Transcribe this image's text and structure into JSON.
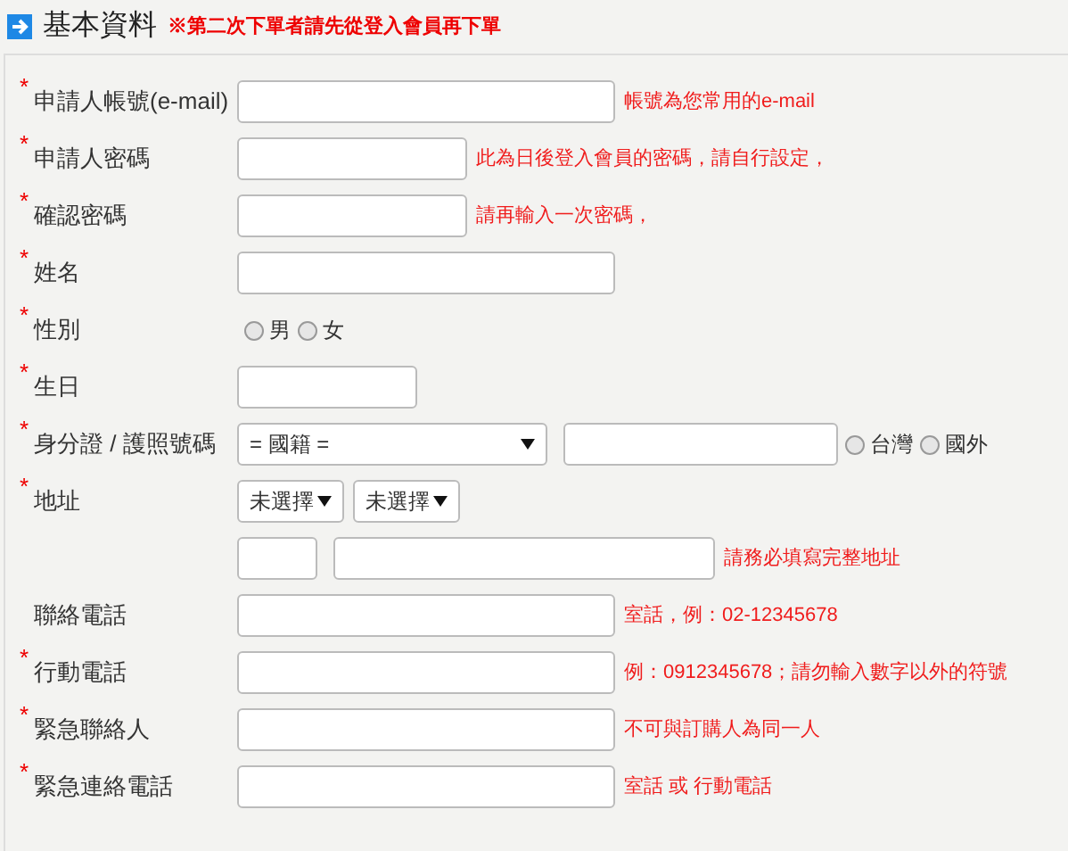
{
  "header": {
    "title": "基本資料",
    "note": "※第二次下單者請先從登入會員再下單"
  },
  "rows": [
    {
      "kind": "text",
      "label": "申請人帳號(e-mail)",
      "marker": "*",
      "hint": "帳號為您常用的e-mail"
    },
    {
      "kind": "text",
      "label": "申請人密碼",
      "marker": "*",
      "hint": "此為日後登入會員的密碼，請自行設定，"
    },
    {
      "kind": "text",
      "label": "確認密碼",
      "marker": "*",
      "hint": "請再輸入一次密碼，"
    },
    {
      "kind": "text",
      "label": "姓名",
      "marker": "*"
    },
    {
      "kind": "radio",
      "label": "性別",
      "marker": "*",
      "options": [
        {
          "label": "男",
          "selected": false
        },
        {
          "label": "女",
          "selected": false
        }
      ]
    },
    {
      "kind": "text",
      "label": "生日",
      "marker": "*"
    },
    {
      "kind": "id",
      "label": "身分證 / 護照號碼",
      "marker": "*",
      "select": "= 國籍 =",
      "options": [
        {
          "label": "台灣",
          "selected": false
        },
        {
          "label": "國外",
          "selected": false
        }
      ]
    },
    {
      "kind": "address",
      "label": "地址",
      "marker": "*",
      "selects": [
        "未選擇",
        "未選擇"
      ]
    },
    {
      "kind": "address2",
      "hint": "請務必填寫完整地址"
    },
    {
      "kind": "text",
      "label": "聯絡電話",
      "hint": "室話，例：02-12345678"
    },
    {
      "kind": "text",
      "label": "行動電話",
      "marker": "*",
      "hint": "例：0912345678；請勿輸入數字以外的符號"
    },
    {
      "kind": "text",
      "label": "緊急聯絡人",
      "marker": "*",
      "hint": "不可與訂購人為同一人"
    },
    {
      "kind": "text",
      "label": "緊急連絡電話",
      "marker": "*",
      "hint": "室話 或 行動電話"
    }
  ]
}
